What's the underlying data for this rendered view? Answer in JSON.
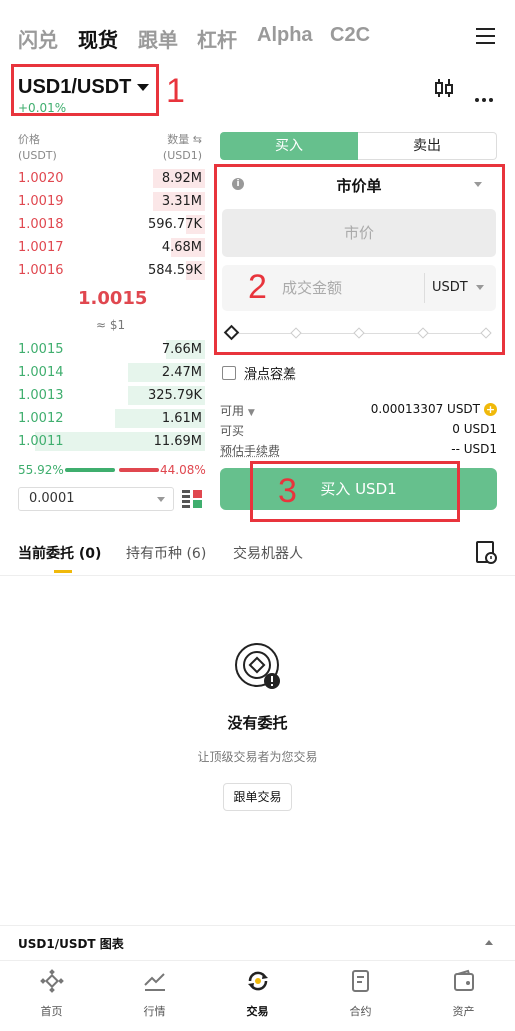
{
  "top_tabs": [
    "闪兑",
    "现货",
    "跟单",
    "杠杆",
    "Alpha",
    "C2C"
  ],
  "pair": {
    "symbol": "USD1/USDT",
    "change": "+0.01%"
  },
  "annotations": [
    "1",
    "2",
    "3"
  ],
  "orderbook": {
    "price_header": "价格",
    "price_unit": "(USDT)",
    "qty_header": "数量 ⇆",
    "qty_unit": "(USD1)",
    "asks": [
      {
        "price": "1.0020",
        "qty": "8.92M",
        "depth": 0.28
      },
      {
        "price": "1.0019",
        "qty": "3.31M",
        "depth": 0.28
      },
      {
        "price": "1.0018",
        "qty": "596.77K",
        "depth": 0.1
      },
      {
        "price": "1.0017",
        "qty": "4.68M",
        "depth": 0.18
      },
      {
        "price": "1.0016",
        "qty": "584.59K",
        "depth": 0.1
      }
    ],
    "mid_price": "1.0015",
    "mid_usd": "≈ $1",
    "bids": [
      {
        "price": "1.0015",
        "qty": "7.66M",
        "depth": 0.21
      },
      {
        "price": "1.0014",
        "qty": "2.47M",
        "depth": 0.41
      },
      {
        "price": "1.0013",
        "qty": "325.79K",
        "depth": 0.41
      },
      {
        "price": "1.0012",
        "qty": "1.61M",
        "depth": 0.48
      },
      {
        "price": "1.0011",
        "qty": "11.69M",
        "depth": 0.91
      }
    ],
    "buy_ratio": "55.92%",
    "sell_ratio": "44.08%",
    "precision": "0.0001"
  },
  "order_form": {
    "buy_tab": "买入",
    "sell_tab": "卖出",
    "order_type": "市价单",
    "market_price_placeholder": "市价",
    "amount_placeholder": "成交金额",
    "amount_unit": "USDT",
    "slippage": "滑点容差",
    "available_label": "可用",
    "available_value": "0.00013307 USDT",
    "can_buy_label": "可买",
    "can_buy_value": "0 USD1",
    "fee_label": "预估手续费",
    "fee_value": "-- USD1",
    "buy_button": "买入 USD1"
  },
  "sub_tabs": [
    "当前委托 (0)",
    "持有币种 (6)",
    "交易机器人"
  ],
  "empty": {
    "title": "没有委托",
    "subtitle": "让顶级交易者为您交易",
    "button": "跟单交易"
  },
  "chart_bar": "USD1/USDT 图表",
  "bottom_nav": [
    "首页",
    "行情",
    "交易",
    "合约",
    "资产"
  ],
  "colors": {
    "buy": "#66c08d",
    "sell": "#e0474f",
    "accent": "#f0b90b",
    "annotation": "#e8343c"
  }
}
